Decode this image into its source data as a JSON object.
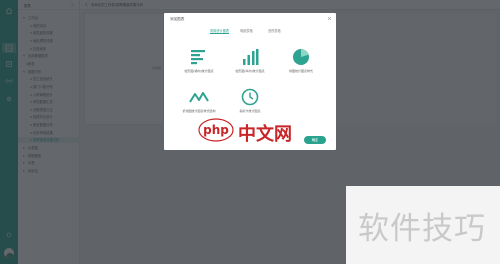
{
  "sidebar": {
    "header": "报表",
    "items": [
      {
        "label": "工作台",
        "level": 1,
        "expand": "down"
      },
      {
        "label": "我的待办",
        "level": 2,
        "badge": "10"
      },
      {
        "label": "我发起的流程",
        "level": 2
      },
      {
        "label": "我处理的流程",
        "level": 2
      },
      {
        "label": "抄送我的",
        "level": 2
      },
      {
        "label": "应用数据报表",
        "level": 1,
        "expand": "down"
      },
      {
        "label": "报表",
        "level": 1
      },
      {
        "label": "数据分析",
        "level": 1,
        "expand": "down"
      },
      {
        "label": "员工信息统计",
        "level": 2
      },
      {
        "label": "部门人数分布",
        "level": 2
      },
      {
        "label": "入职离职统计",
        "level": 2
      },
      {
        "label": "考勤数据汇总",
        "level": 2
      },
      {
        "label": "请假类型占比",
        "level": 2
      },
      {
        "label": "加班时长统计",
        "level": 2
      },
      {
        "label": "薪资数据分析",
        "level": 2
      },
      {
        "label": "绩效考核结果",
        "level": 2
      },
      {
        "label": "招聘渠道效果分析",
        "level": 2,
        "selected": true
      },
      {
        "label": "仪表盘",
        "level": 1,
        "expand": "right"
      },
      {
        "label": "数据看板",
        "level": 1,
        "expand": "right"
      },
      {
        "label": "标签",
        "level": 1,
        "expand": "right"
      },
      {
        "label": "回收站",
        "level": 1,
        "expand": "right"
      }
    ]
  },
  "topbar": {
    "title": "未命名的工作表/招聘渠道效果分析"
  },
  "canvas": {
    "hint": "请选择"
  },
  "modal": {
    "title": "添加图表",
    "tabs": [
      "常用统计图表",
      "明细表格",
      "透视表格"
    ],
    "active_tab": 0,
    "cards": [
      {
        "label": "柱形图(横向)统计图表",
        "icon": "horizontal-bar-chart-icon"
      },
      {
        "label": "柱形图(纵向)统计图表",
        "icon": "vertical-bar-chart-icon"
      },
      {
        "label": "饼图统计图表样式",
        "icon": "pie-chart-icon"
      },
      {
        "label": "折线图统计图表样式结构",
        "icon": "line-chart-icon"
      },
      {
        "label": "指标卡统计图表",
        "icon": "clock-icon"
      }
    ],
    "confirm": "确定"
  },
  "watermarks": {
    "php_logo": "php",
    "php_cn": "中文网",
    "corner": "软件技巧"
  },
  "colors": {
    "rail": "#22a38e",
    "accent": "#2ea391",
    "watermark_red": "#c82528"
  }
}
